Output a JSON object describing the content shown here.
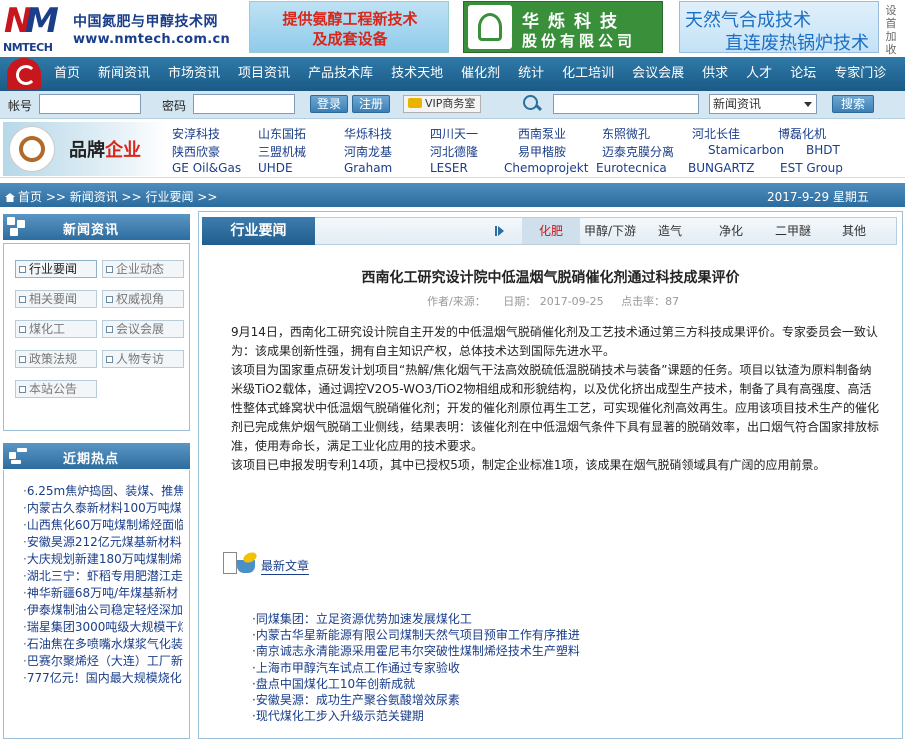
{
  "header": {
    "logo_text": "NMTECH",
    "site_name": "中国氮肥与甲醇技术网",
    "site_url": "www.nmtech.com.cn",
    "ad1_line1": "提供氨醇工程新技术",
    "ad1_line2": "及成套设备",
    "ad2_line1": "华烁科技",
    "ad2_line2": "股份有限公司",
    "ad3_line1": "天然气合成技术",
    "ad3_line2": "直连废热锅炉技术",
    "side_links": [
      "设",
      "首",
      "加",
      "收"
    ]
  },
  "nav": {
    "items": [
      "首页",
      "新闻资讯",
      "市场资讯",
      "项目资讯",
      "产品技术库",
      "技术天地",
      "催化剂",
      "统计",
      "化工培训",
      "会议会展",
      "供求",
      "人才",
      "论坛",
      "专家门诊"
    ]
  },
  "searchbar": {
    "account_label": "帐号",
    "password_label": "密码",
    "login_label": "登录",
    "register_label": "注册",
    "vip_label": "VIP商务室",
    "category_value": "新闻资讯",
    "search_label": "搜索"
  },
  "brands": {
    "title_a": "品牌",
    "title_b": "企业",
    "row1": [
      "安淳科技",
      "山东国拓",
      "华烁科技",
      "四川天一",
      "西南泵业",
      "东照微孔",
      "河北长佳",
      "博磊化机"
    ],
    "row2": [
      "陕西欣豪",
      "三盟机械",
      "河南龙基",
      "河北德隆",
      "易甲楷胺",
      "迈泰克膜分离",
      "Stamicarbon",
      "BHDT"
    ],
    "row3": [
      "GE Oil&Gas",
      "UHDE",
      "Graham",
      "LESER",
      "Chemoprojekt",
      "Eurotecnica",
      "BUNGARTZ",
      "EST Group"
    ]
  },
  "breadcrumb": {
    "path": "首页 >> 新闻资讯 >> 行业要闻 >>",
    "date": "2017-9-29  星期五"
  },
  "sidebar": {
    "news_title": "新闻资讯",
    "news_links": [
      "行业要闻",
      "企业动态",
      "相关要闻",
      "权威视角",
      "煤化工",
      "会议会展",
      "政策法规",
      "人物专访",
      "本站公告"
    ],
    "hot_title": "近期热点",
    "hot_items": [
      {
        "a": "·",
        "b": "6.25m焦炉捣固、装煤、推焦"
      },
      {
        "a": "·",
        "b": "内蒙古久泰新材料100万吨煤"
      },
      {
        "a": "·",
        "b": "山西焦化60万吨煤制烯烃面临"
      },
      {
        "a": "·",
        "b": "安徽昊源212亿元煤基新材料"
      },
      {
        "a": "·",
        "b": "大庆规划新建180万吨煤制烯"
      },
      {
        "a": "·",
        "b": "湖北三宁：虾稻专用肥潜江走"
      },
      {
        "a": "·",
        "b": "神华新疆68万吨/年煤基新材"
      },
      {
        "a": "·",
        "b": "伊泰煤制油公司稳定轻烃深加"
      },
      {
        "a": "·",
        "b": "瑞星集团3000吨级大规模干煤"
      },
      {
        "a": "·",
        "b": "石油焦在多喷嘴水煤浆气化装"
      },
      {
        "a": "·",
        "b": "巴赛尔聚烯烃（大连）工厂新"
      },
      {
        "a": "·",
        "b": "777亿元！国内最大规模烧化"
      }
    ]
  },
  "main": {
    "section_title": "行业要闻",
    "tabs": [
      "化肥",
      "甲醇/下游",
      "造气",
      "净化",
      "二甲醚",
      "其他"
    ],
    "article_title": "西南化工研究设计院中低温烟气脱硝催化剂通过科技成果评价",
    "meta_author": "作者/来源：",
    "meta_date": "日期：  2017-09-25",
    "meta_clicks": "点击率：87",
    "paragraphs": [
      "9月14日，西南化工研究设计院自主开发的中低温烟气脱硝催化剂及工艺技术通过第三方科技成果评价。专家委员会一致认为：该成果创新性强，拥有自主知识产权，总体技术达到国际先进水平。",
      "该项目为国家重点研发计划项目“热解/焦化烟气干法高效脱硫低温脱硝技术与装备”课题的任务。项目以钛渣为原料制备纳米级TiO2载体，通过调控V2O5-WO3/TiO2物相组成和形貌结构，以及优化挤出成型生产技术，制备了具有高强度、高活性整体式蜂窝状中低温烟气脱硝催化剂；开发的催化剂原位再生工艺，可实现催化剂高效再生。应用该项目技术生产的催化剂已完成焦炉烟气脱硝工业侧线，结果表明：该催化剂在中低温烟气条件下具有显著的脱硝效率，出口烟气符合国家排放标准，使用寿命长，满足工业化应用的技术要求。",
      "该项目已申报发明专利14项，其中已授权5项，制定企业标准1项，该成果在烟气脱硝领域具有广阔的应用前景。"
    ],
    "latest_label": "最新文章",
    "latest_items": [
      "同煤集团：立足资源优势加速发展煤化工",
      "内蒙古华星新能源有限公司煤制天然气项目预审工作有序推进",
      "南京诚志永清能源采用霍尼韦尔突破性煤制烯烃技术生产塑料",
      "上海市甲醇汽车试点工作通过专家验收",
      "盘点中国煤化工10年创新成就",
      "安徽昊源：成功生产聚谷氨酸增效尿素",
      "现代煤化工步入升级示范关键期"
    ]
  },
  "colors": {
    "brand_blue": "#1a3e8a",
    "nav_blue": "#2f7aa8",
    "accent_red": "#c8161d"
  }
}
